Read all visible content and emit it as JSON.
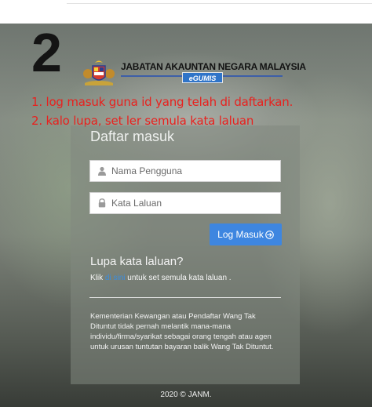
{
  "step_number": "2",
  "header": {
    "agency_name": "JABATAN AKAUNTAN NEGARA MALAYSIA",
    "system_badge": "eGUMIS",
    "crest_icon": "malaysia-coat-of-arms-icon"
  },
  "annotations": {
    "line1": "1. log masuk guna id yang telah di daftarkan.",
    "line2": "2. kalo lupa, set ler semula kata laluan",
    "color": "#e8211e"
  },
  "login": {
    "title": "Daftar masuk",
    "username": {
      "placeholder": "Nama Pengguna",
      "value": "",
      "icon": "user-icon"
    },
    "password": {
      "placeholder": "Kata Laluan",
      "value": "",
      "icon": "lock-icon"
    },
    "submit_label": "Log Masuk",
    "submit_icon": "arrow-right-circle-icon",
    "accent": "#3e86e0"
  },
  "forgot": {
    "title": "Lupa kata laluan?",
    "prefix": "Klik",
    "link_text": "di sini",
    "suffix": "untuk set semula kata laluan ."
  },
  "disclaimer": "Kementerian Kewangan atau Pendaftar Wang Tak Dituntut tidak pernah melantik mana-mana individu/firma/syarikat sebagai orang tengah atau agen untuk urusan tuntutan bayaran balik Wang Tak Dituntut.",
  "footer": "2020 © JANM."
}
